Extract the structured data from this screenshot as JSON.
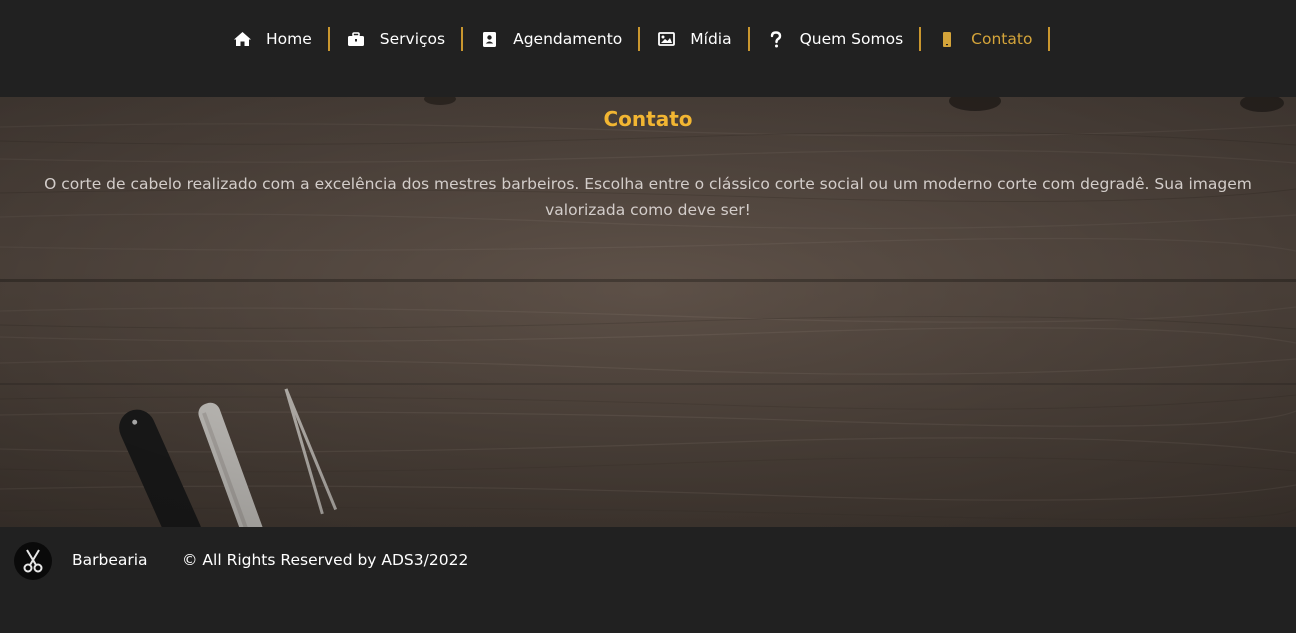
{
  "nav": {
    "items": [
      {
        "label": "Home",
        "icon": "home-icon"
      },
      {
        "label": "Serviços",
        "icon": "briefcase-icon"
      },
      {
        "label": "Agendamento",
        "icon": "contact-book-icon"
      },
      {
        "label": "Mídia",
        "icon": "image-icon"
      },
      {
        "label": "Quem Somos",
        "icon": "question-icon"
      },
      {
        "label": "Contato",
        "icon": "mobile-phone-icon",
        "active": true
      }
    ]
  },
  "hero": {
    "title": "Contato",
    "text": "O corte de cabelo realizado com a excelência dos mestres barbeiros. Escolha entre o clássico corte social ou um moderno corte com degradê. Sua imagem valorizada como deve ser!"
  },
  "footer": {
    "logo_icon": "scissors-icon",
    "brand": "Barbearia",
    "copyright": "© All Rights Reserved by ADS3/2022"
  },
  "colors": {
    "background": "#212121",
    "accent": "#f2b632",
    "active_nav": "#d4a43a",
    "separator": "#c9962e",
    "hero_text": "#d3cdca"
  }
}
